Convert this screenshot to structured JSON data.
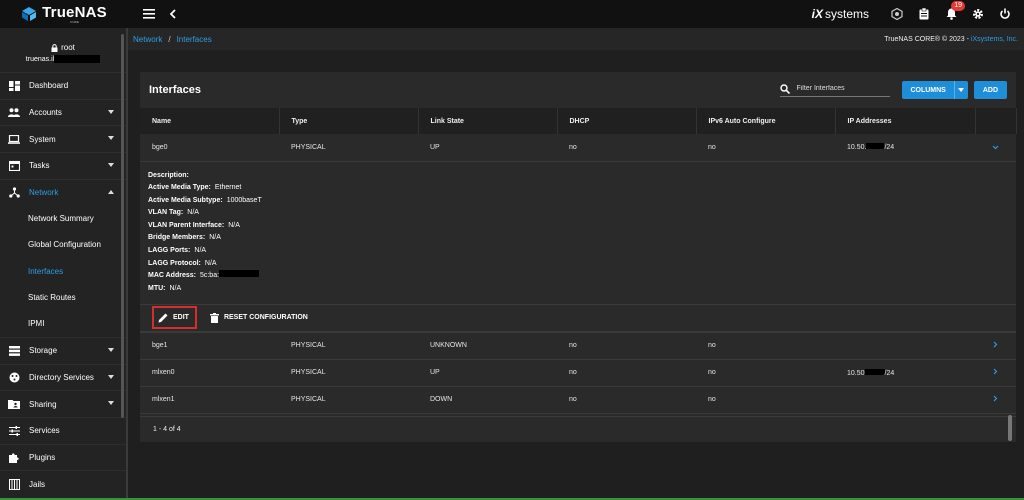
{
  "brand": {
    "name": "TrueNAS",
    "sub": "CORE"
  },
  "topbar": {
    "vendor_mark": "iX",
    "vendor_name": "systems",
    "notifications": "19"
  },
  "user": {
    "name": "root",
    "host": "truenas.il"
  },
  "sidebar": {
    "items": [
      {
        "label": "Dashboard"
      },
      {
        "label": "Accounts"
      },
      {
        "label": "System"
      },
      {
        "label": "Tasks"
      },
      {
        "label": "Network"
      }
    ],
    "network_sub": [
      {
        "label": "Network Summary"
      },
      {
        "label": "Global Configuration"
      },
      {
        "label": "Interfaces"
      },
      {
        "label": "Static Routes"
      },
      {
        "label": "IPMI"
      }
    ],
    "items_after": [
      {
        "label": "Storage"
      },
      {
        "label": "Directory Services"
      },
      {
        "label": "Sharing"
      },
      {
        "label": "Services"
      },
      {
        "label": "Plugins"
      },
      {
        "label": "Jails"
      }
    ]
  },
  "breadcrumb": {
    "network": "Network",
    "sep": "/",
    "interfaces": "Interfaces"
  },
  "copyright": {
    "text": "TrueNAS CORE® © 2023 - ",
    "link": "iXsystems, Inc."
  },
  "card": {
    "title": "Interfaces",
    "filter_placeholder": "Filter Interfaces",
    "columns_label": "COLUMNS",
    "add_label": "ADD"
  },
  "table": {
    "headers": [
      "Name",
      "Type",
      "Link State",
      "DHCP",
      "IPv6 Auto Configure",
      "IP Addresses"
    ],
    "rows": [
      {
        "name": "bge0",
        "type": "PHYSICAL",
        "link": "UP",
        "dhcp": "no",
        "ipv6": "no",
        "ip_prefix": "10.50.",
        "ip_suffix": "/24"
      },
      {
        "name": "bge1",
        "type": "PHYSICAL",
        "link": "UNKNOWN",
        "dhcp": "no",
        "ipv6": "no",
        "ip_prefix": "",
        "ip_suffix": ""
      },
      {
        "name": "mlxen0",
        "type": "PHYSICAL",
        "link": "UP",
        "dhcp": "no",
        "ipv6": "no",
        "ip_prefix": "10.50",
        "ip_suffix": "/24"
      },
      {
        "name": "mlxen1",
        "type": "PHYSICAL",
        "link": "DOWN",
        "dhcp": "no",
        "ipv6": "no",
        "ip_prefix": "",
        "ip_suffix": ""
      }
    ]
  },
  "detail": {
    "description_label": "Description:",
    "active_media_type_label": "Active Media Type:",
    "active_media_type": "Ethernet",
    "active_media_subtype_label": "Active Media Subtype:",
    "active_media_subtype": "1000baseT",
    "vlan_tag_label": "VLAN Tag:",
    "vlan_tag": "N/A",
    "vlan_parent_label": "VLAN Parent Interface:",
    "vlan_parent": "N/A",
    "bridge_members_label": "Bridge Members:",
    "bridge_members": "N/A",
    "lagg_ports_label": "LAGG Ports:",
    "lagg_ports": "N/A",
    "lagg_protocol_label": "LAGG Protocol:",
    "lagg_protocol": "N/A",
    "mac_label": "MAC Address:",
    "mac": "5c:ba:",
    "mtu_label": "MTU:",
    "mtu": "N/A"
  },
  "actions": {
    "edit": "EDIT",
    "reset": "RESET CONFIGURATION"
  },
  "footer": {
    "range": "1 - 4 of 4"
  },
  "colors": {
    "accent": "#1e8ed8",
    "link": "#2b9de8",
    "highlight_box": "#d32f2f"
  }
}
